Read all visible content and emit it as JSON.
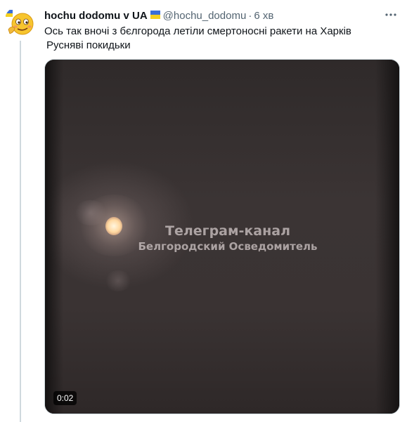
{
  "tweet": {
    "display_name": "hochu dodomu v UA",
    "handle": "@hochu_dodomu",
    "separator": "·",
    "time": "6 хв",
    "text_line1": "Ось так вночі з бєлгорода летіли смертоносні ракети на  Харків",
    "text_line2": "Русняві покидьки"
  },
  "media": {
    "watermark_line1": "Телеграм-канал",
    "watermark_line2": "Белгородский Осведомитель",
    "duration": "0:02"
  },
  "icons": {
    "avatar": "emoji-avatar-icon",
    "more": "more-options-icon",
    "flag": "ukraine-flag-icon"
  },
  "colors": {
    "text_primary": "#0f1419",
    "text_secondary": "#536471",
    "border": "#cfd9de"
  }
}
